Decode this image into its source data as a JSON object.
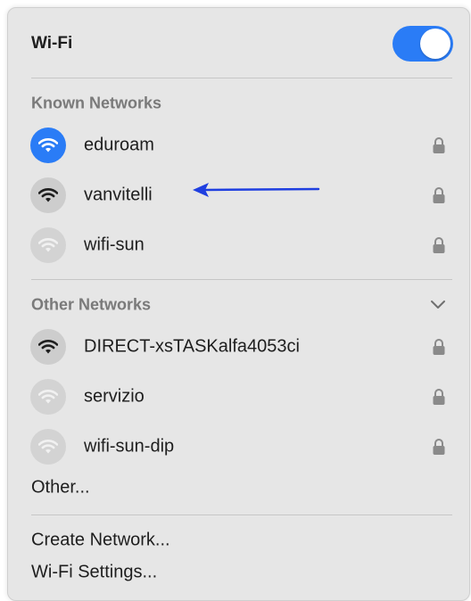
{
  "header": {
    "title": "Wi-Fi",
    "toggle_on": true
  },
  "known": {
    "title": "Known Networks",
    "items": [
      {
        "name": "eduroam",
        "icon": "wifi-icon",
        "state": "connected",
        "secured": true
      },
      {
        "name": "vanvitelli",
        "icon": "wifi-icon",
        "state": "strong",
        "secured": true
      },
      {
        "name": "wifi-sun",
        "icon": "wifi-icon",
        "state": "weak",
        "secured": true
      }
    ]
  },
  "other": {
    "title": "Other Networks",
    "expand_icon": "chevron-down-icon",
    "items": [
      {
        "name": "DIRECT-xsTASKalfa4053ci",
        "icon": "wifi-icon",
        "state": "strong",
        "secured": true
      },
      {
        "name": "servizio",
        "icon": "wifi-icon",
        "state": "weak",
        "secured": true
      },
      {
        "name": "wifi-sun-dip",
        "icon": "wifi-icon",
        "state": "weak",
        "secured": true
      }
    ],
    "other_label": "Other..."
  },
  "footer": {
    "create_label": "Create Network...",
    "settings_label": "Wi-Fi Settings..."
  },
  "colors": {
    "accent": "#2a7cf6",
    "annotation_arrow": "#1f3fe0",
    "panel_bg": "#e6e6e6"
  }
}
